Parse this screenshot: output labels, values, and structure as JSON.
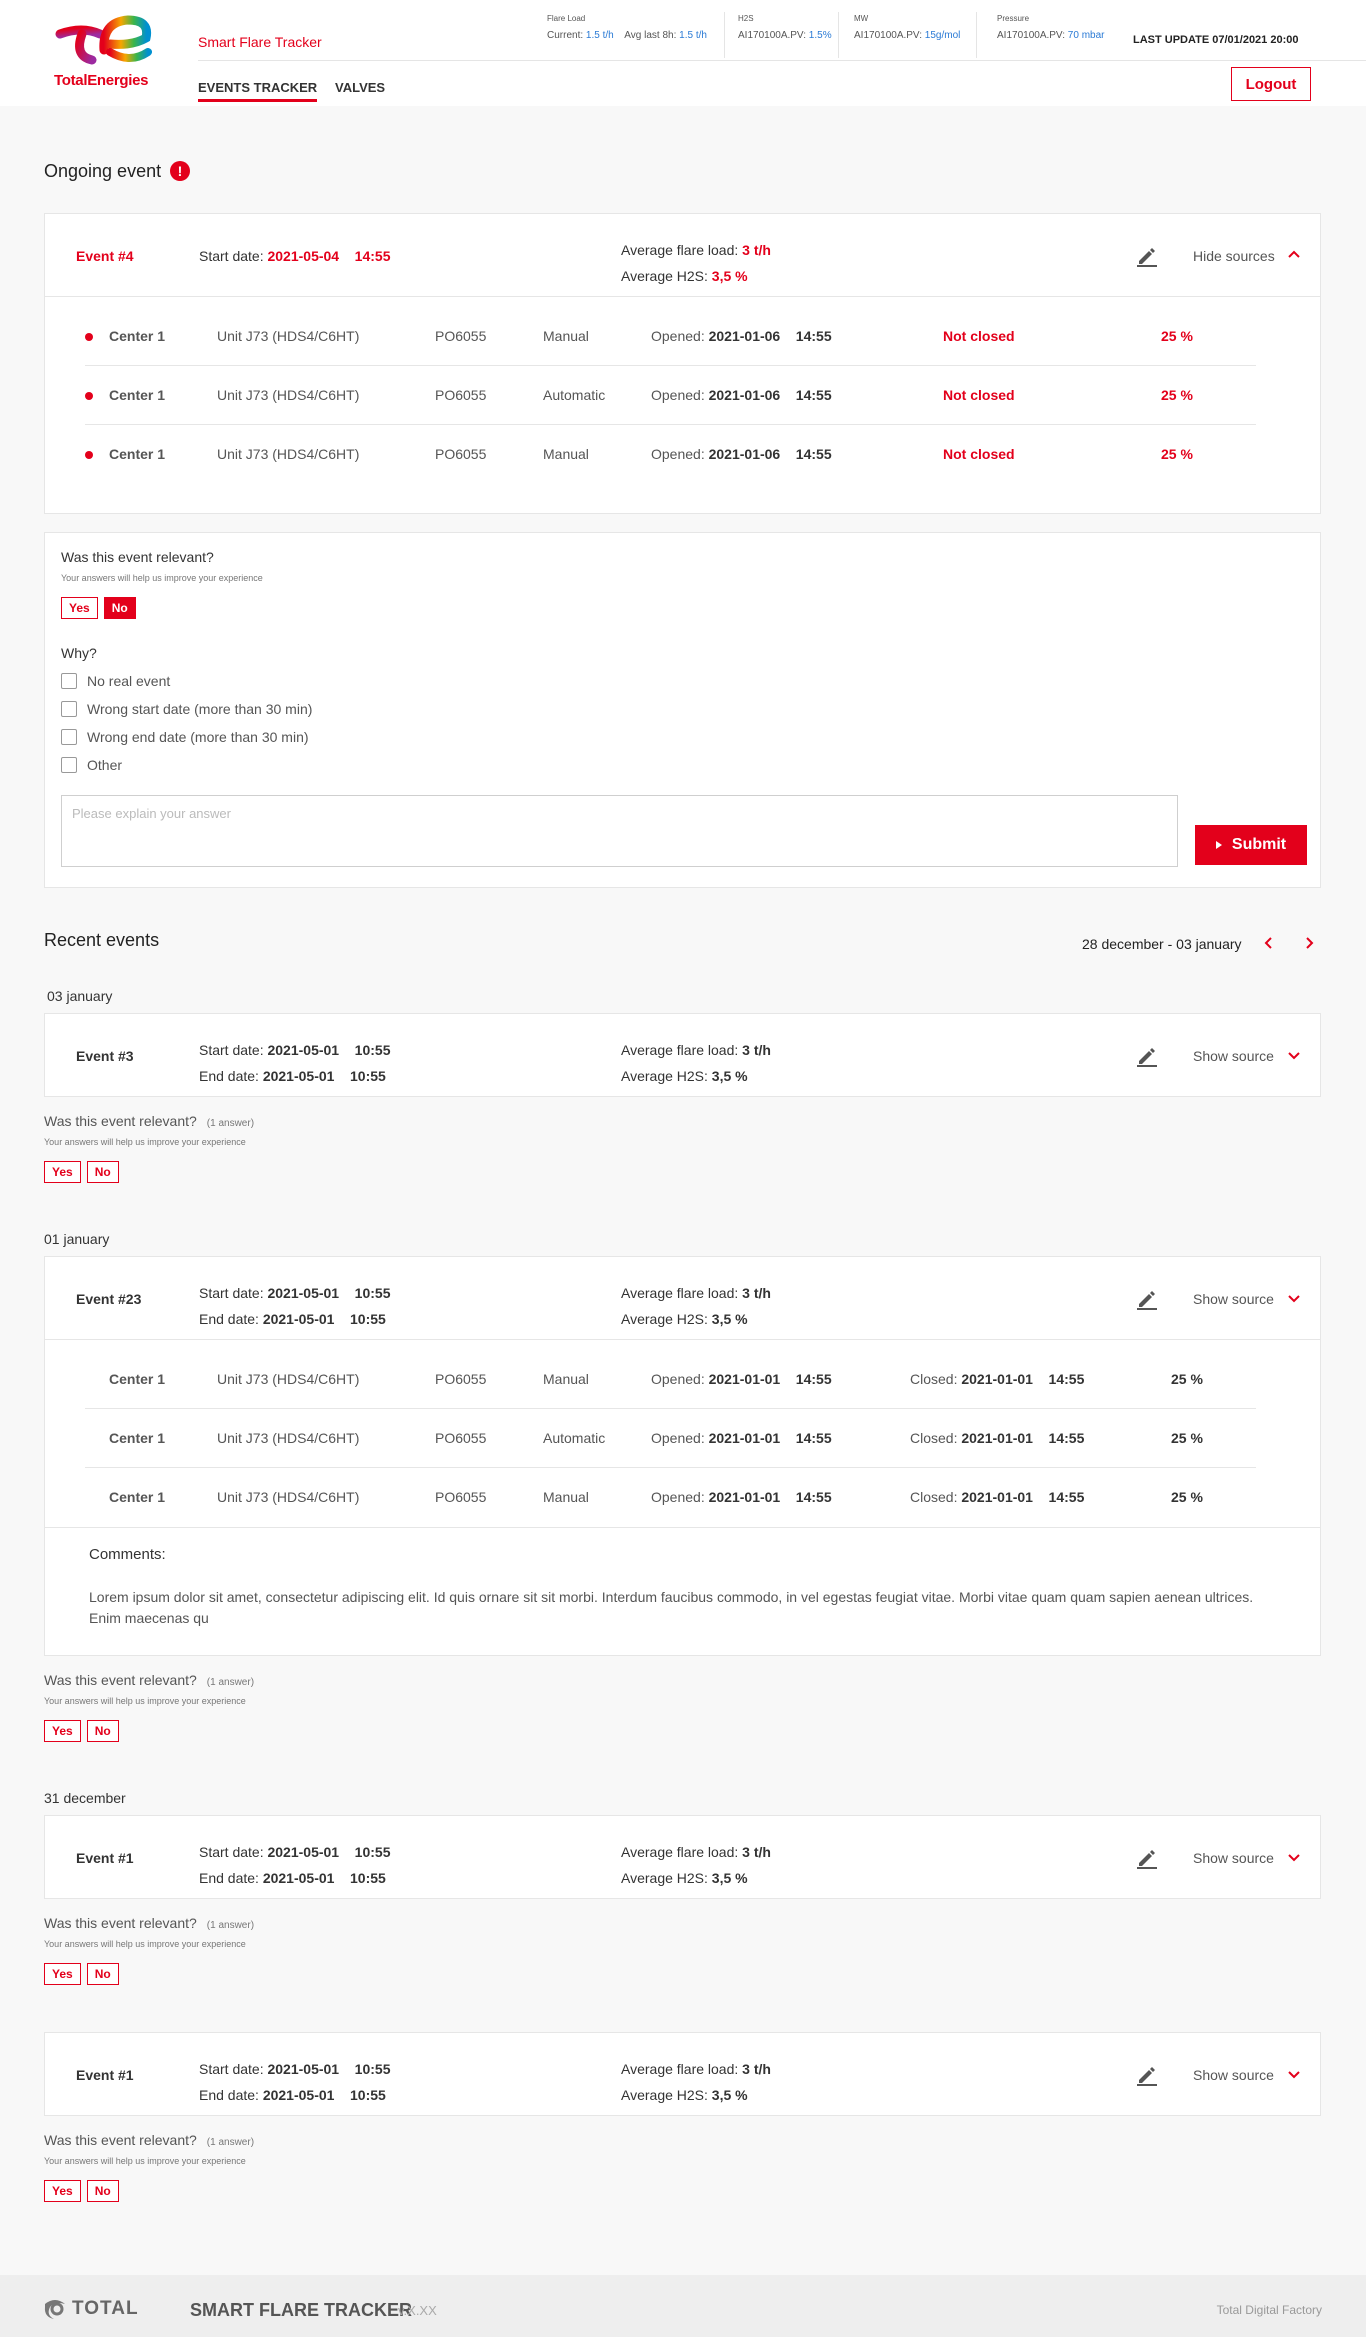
{
  "header": {
    "logo_text": "TotalEnergies",
    "app_name": "Smart Flare Tracker",
    "tabs": [
      {
        "label": "EVENTS TRACKER",
        "active": true
      },
      {
        "label": "VALVES",
        "active": false
      }
    ],
    "metrics": {
      "flare_load": {
        "title": "Flare Load",
        "current_label": "Current:",
        "current_value": "1.5 t/h",
        "avg_label": "Avg last 8h:",
        "avg_value": "1.5 t/h"
      },
      "h2s": {
        "title": "H2S",
        "tag": "AI170100A.PV:",
        "value": "1.5%"
      },
      "mw": {
        "title": "MW",
        "tag": "AI170100A.PV:",
        "value": "15g/mol"
      },
      "pressure": {
        "title": "Pressure",
        "tag": "AI170100A.PV:",
        "value": "70 mbar"
      }
    },
    "last_update": "LAST UPDATE 07/01/2021 20:00",
    "logout_label": "Logout"
  },
  "ongoing": {
    "title": "Ongoing event",
    "alert_symbol": "!",
    "event": {
      "id": "Event #4",
      "start_label": "Start date:",
      "start_date": "2021-05-04",
      "start_time": "14:55",
      "avg_load_label": "Average flare load:",
      "avg_load": "3 t/h",
      "avg_h2s_label": "Average H2S:",
      "avg_h2s": "3,5 %",
      "toggle_label": "Hide sources",
      "sources": [
        {
          "center": "Center 1",
          "unit": "Unit J73 (HDS4/C6HT)",
          "tag": "PO6055",
          "mode": "Manual",
          "opened_label": "Opened:",
          "opened_date": "2021-01-06",
          "opened_time": "14:55",
          "status": "Not closed",
          "percent": "25 %"
        },
        {
          "center": "Center 1",
          "unit": "Unit J73 (HDS4/C6HT)",
          "tag": "PO6055",
          "mode": "Automatic",
          "opened_label": "Opened:",
          "opened_date": "2021-01-06",
          "opened_time": "14:55",
          "status": "Not closed",
          "percent": "25 %"
        },
        {
          "center": "Center 1",
          "unit": "Unit J73 (HDS4/C6HT)",
          "tag": "PO6055",
          "mode": "Manual",
          "opened_label": "Opened:",
          "opened_date": "2021-01-06",
          "opened_time": "14:55",
          "status": "Not closed",
          "percent": "25 %"
        }
      ]
    },
    "feedback": {
      "question": "Was this event relevant?",
      "hint": "Your answers will help us improve your experience",
      "yes": "Yes",
      "no": "No",
      "why": "Why?",
      "options": [
        "No real event",
        "Wrong start date (more than 30 min)",
        "Wrong end date (more than 30 min)",
        "Other"
      ],
      "placeholder": "Please explain your answer",
      "submit": "Submit"
    }
  },
  "recent": {
    "title": "Recent events",
    "range": "28 december - 03 january",
    "labels": {
      "start": "Start date:",
      "end": "End date:",
      "avg_load": "Average flare load:",
      "avg_h2s": "Average H2S:",
      "show_source": "Show source",
      "question": "Was this event relevant?",
      "answers": "(1 answer)",
      "hint": "Your answers will help us improve your experience",
      "yes": "Yes",
      "no": "No",
      "opened": "Opened:",
      "closed": "Closed:",
      "comments": "Comments:"
    },
    "groups": [
      {
        "date": "03 january"
      },
      {
        "date": "01 january"
      },
      {
        "date": "31 december"
      }
    ],
    "events": [
      {
        "id": "Event #3",
        "start_date": "2021-05-01",
        "start_time": "10:55",
        "end_date": "2021-05-01",
        "end_time": "10:55",
        "avg_load": "3 t/h",
        "avg_h2s": "3,5 %"
      },
      {
        "id": "Event #23",
        "start_date": "2021-05-01",
        "start_time": "10:55",
        "end_date": "2021-05-01",
        "end_time": "10:55",
        "avg_load": "3 t/h",
        "avg_h2s": "3,5 %",
        "sources": [
          {
            "center": "Center 1",
            "unit": "Unit J73 (HDS4/C6HT)",
            "tag": "PO6055",
            "mode": "Manual",
            "opened_date": "2021-01-01",
            "opened_time": "14:55",
            "closed_date": "2021-01-01",
            "closed_time": "14:55",
            "percent": "25 %"
          },
          {
            "center": "Center 1",
            "unit": "Unit J73 (HDS4/C6HT)",
            "tag": "PO6055",
            "mode": "Automatic",
            "opened_date": "2021-01-01",
            "opened_time": "14:55",
            "closed_date": "2021-01-01",
            "closed_time": "14:55",
            "percent": "25 %"
          },
          {
            "center": "Center 1",
            "unit": "Unit J73 (HDS4/C6HT)",
            "tag": "PO6055",
            "mode": "Manual",
            "opened_date": "2021-01-01",
            "opened_time": "14:55",
            "closed_date": "2021-01-01",
            "closed_time": "14:55",
            "percent": "25 %"
          }
        ],
        "comment": "Lorem ipsum dolor sit amet, consectetur adipiscing elit. Id quis ornare sit sit morbi. Interdum faucibus commodo, in vel egestas feugiat vitae. Morbi vitae quam quam sapien aenean ultrices. Enim maecenas qu"
      },
      {
        "id": "Event #1",
        "start_date": "2021-05-01",
        "start_time": "10:55",
        "end_date": "2021-05-01",
        "end_time": "10:55",
        "avg_load": "3 t/h",
        "avg_h2s": "3,5 %"
      },
      {
        "id": "Event #1",
        "start_date": "2021-05-01",
        "start_time": "10:55",
        "end_date": "2021-05-01",
        "end_time": "10:55",
        "avg_load": "3 t/h",
        "avg_h2s": "3,5 %"
      }
    ]
  },
  "footer": {
    "brand": "TOTAL",
    "title": "SMART FLARE TRACKER",
    "version": "v.X.XX",
    "right": "Total Digital Factory"
  },
  "colors": {
    "accent": "#e3001b",
    "link_blue": "#2a7ad5",
    "background": "#f8f8f8"
  },
  "icons": [
    "pencil-edit-icon",
    "chevron-up-icon",
    "chevron-down-icon",
    "chevron-left-icon",
    "chevron-right-icon",
    "alert-icon",
    "play-icon",
    "checkbox-icon"
  ]
}
